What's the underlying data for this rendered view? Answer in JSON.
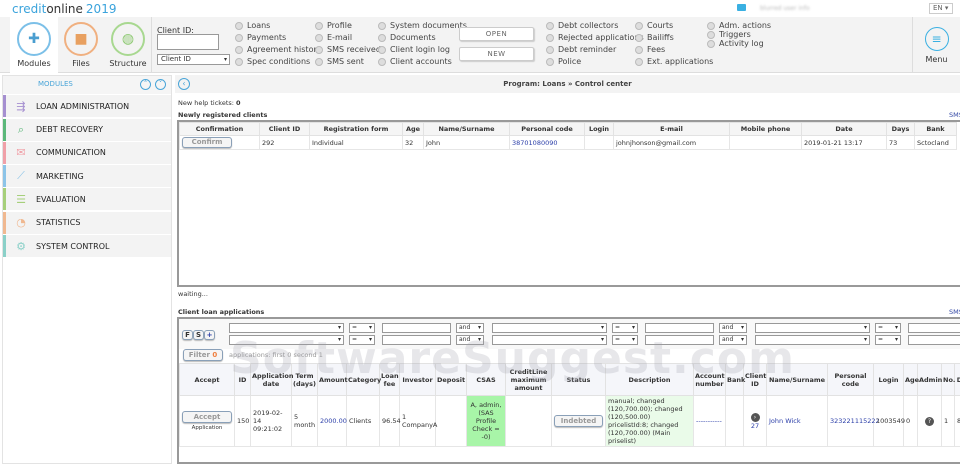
{
  "header": {
    "logo_prefix": "credit",
    "logo_suffix": "online",
    "logo_year": "2019",
    "lang": "EN ▾",
    "user_info": "blurred user info"
  },
  "toolbar": {
    "modules": "Modules",
    "files": "Files",
    "structure": "Structure",
    "client_id_label": "Client ID:",
    "client_id_value": "",
    "client_id_select": "Client ID",
    "open": "OPEN",
    "new": "NEW",
    "menu": "Menu",
    "col1": [
      "Loans",
      "Payments",
      "Agreement history",
      "Spec conditions"
    ],
    "col2": [
      "Profile",
      "E-mail",
      "SMS received",
      "SMS sent"
    ],
    "col3": [
      "System documents",
      "Documents",
      "Client login log",
      "Client accounts"
    ],
    "col4": [
      "Debt collectors",
      "Rejected applications",
      "Debt reminder",
      "Police"
    ],
    "col5": [
      "Courts",
      "Bailiffs",
      "Fees",
      "Ext. applications"
    ],
    "col6": [
      "Adm. actions",
      "Triggers",
      "Activity log"
    ]
  },
  "sidebar": {
    "title": "MODULES",
    "items": [
      {
        "label": "LOAN ADMINISTRATION",
        "color": "#a58fd0",
        "icon": "⇶"
      },
      {
        "label": "DEBT RECOVERY",
        "color": "#5cb87a",
        "icon": "⌕"
      },
      {
        "label": "COMMUNICATION",
        "color": "#f0a0a8",
        "icon": "✉"
      },
      {
        "label": "MARKETING",
        "color": "#8cc4e8",
        "icon": "⟋"
      },
      {
        "label": "EVALUATION",
        "color": "#a6cf7a",
        "icon": "☰"
      },
      {
        "label": "STATISTICS",
        "color": "#f0b890",
        "icon": "◔"
      },
      {
        "label": "SYSTEM CONTROL",
        "color": "#8ad0c8",
        "icon": "⚙"
      }
    ]
  },
  "main": {
    "title": "Program: Loans » Control center",
    "help_label": "New help tickets:",
    "help_count": "0",
    "new_clients_title": "Newly registered clients",
    "sms": "SMS",
    "waiting": "waiting...",
    "loan_apps_title": "Client loan applications",
    "filter_label": "Filter",
    "filter_count": "0",
    "apps_info": "applications: first 0 second 1",
    "fs_buttons": [
      "F",
      "S",
      "+"
    ],
    "op_eq": "=",
    "op_and": "and"
  },
  "clients_table": {
    "headers": [
      "Confirmation",
      "Client ID",
      "Registration form",
      "Age",
      "Name/Surname",
      "Personal code",
      "Login",
      "E-mail",
      "Mobile phone",
      "Date",
      "Days",
      "Bank"
    ],
    "rows": [
      [
        "Confirm",
        "292",
        "Individual",
        "32",
        "John",
        "38701080090",
        "",
        "johnjhonson@gmail.com",
        "",
        "2019-01-21 13:17",
        "73",
        "Sctocland"
      ]
    ]
  },
  "loans_table": {
    "headers": [
      "Accept",
      "ID",
      "Application date",
      "Term (days)",
      "Amount",
      "Category",
      "Loan fee",
      "Investor",
      "Deposit",
      "CSAS",
      "CreditLine maximum amount",
      "Status",
      "Description",
      "Account number",
      "Bank",
      "Client ID",
      "Name/Surname",
      "Personal code",
      "Login",
      "Age",
      "Admin",
      "No.",
      "D"
    ],
    "rows": [
      [
        "Accept|Application",
        "150",
        "2019-02-14 09:21:02",
        "5 month",
        "2000.00",
        "Clients",
        "96.54",
        "1 CompanyA",
        "",
        "A, admin, (SAS Profile Check = -0)",
        "",
        "Indebted",
        "manual; changed (120,700.00); changed (120,500.00) pricelistId:8; changed (120,700.00) (Main priselist)",
        "-----------",
        "",
        "27",
        "John Wick",
        "323221115222",
        "1003549",
        "0",
        "?",
        "1",
        "8"
      ]
    ]
  },
  "watermark": "SoftwareSuggest.com"
}
